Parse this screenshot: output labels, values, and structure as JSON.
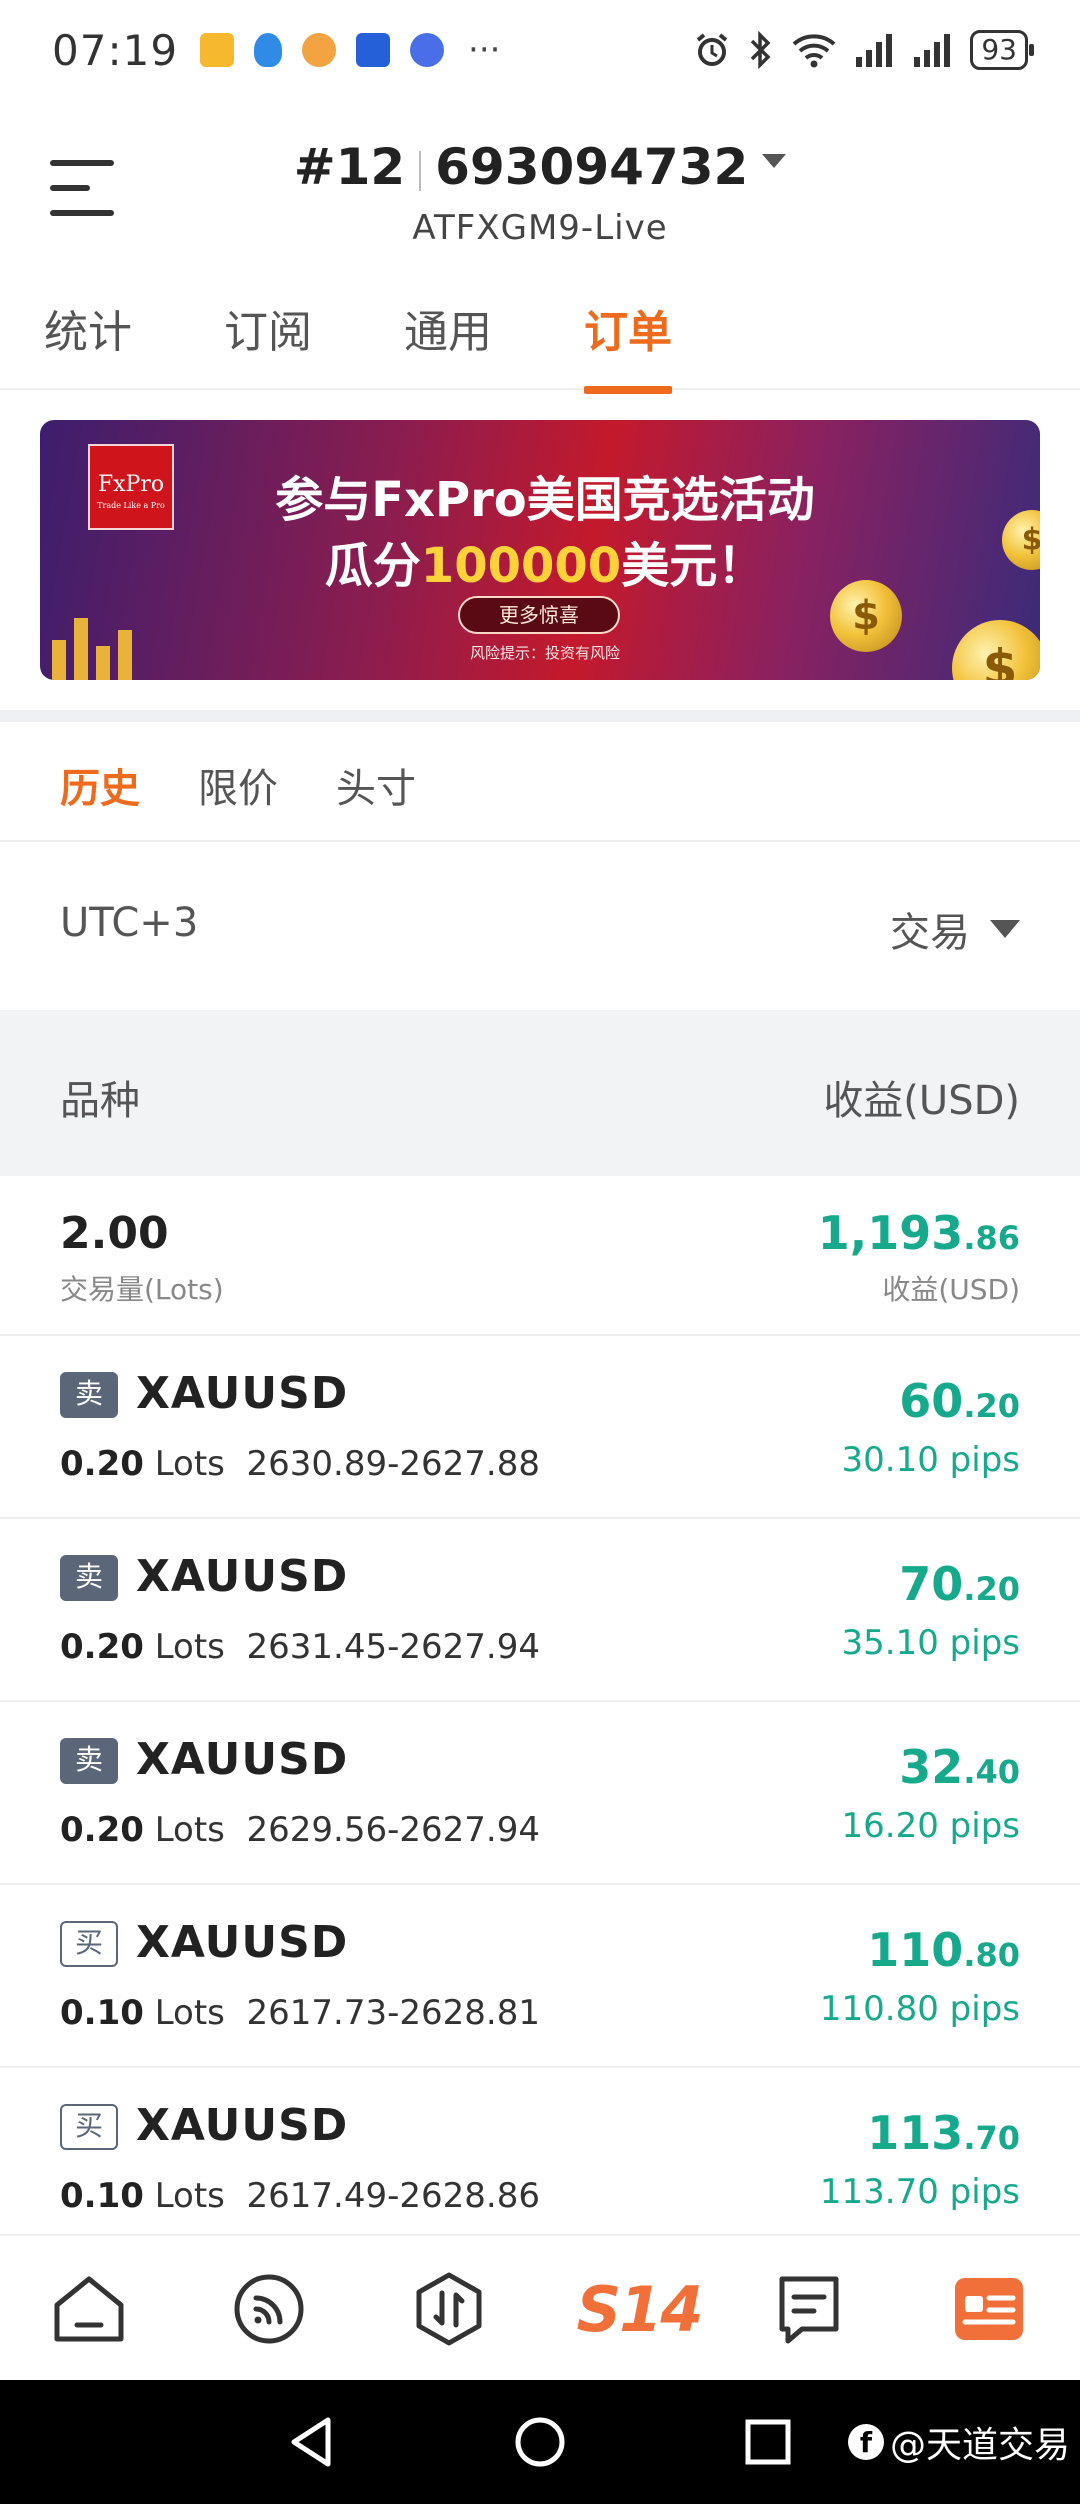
{
  "status_bar": {
    "time": "07:19",
    "more": "···",
    "battery": "93"
  },
  "header": {
    "account_prefix": "#12",
    "account_number": "693094732",
    "server": "ATFXGM9-Live"
  },
  "main_tabs": [
    {
      "label": "统计"
    },
    {
      "label": "订阅"
    },
    {
      "label": "通用"
    },
    {
      "label": "订单",
      "active": true
    }
  ],
  "banner": {
    "logo_text": "FxPro",
    "logo_tagline": "Trade Like a Pro",
    "line1": "参与FxPro美国竞选活动",
    "line2_prefix": "瓜分",
    "line2_amount": "100000",
    "line2_suffix": "美元！",
    "button": "更多惊喜",
    "risk": "风险提示：投资有风险"
  },
  "sub_tabs": [
    {
      "label": "历史",
      "active": true
    },
    {
      "label": "限价"
    },
    {
      "label": "头寸"
    }
  ],
  "filter": {
    "timezone": "UTC+3",
    "type": "交易"
  },
  "columns": {
    "left": "品种",
    "right": "收益(USD)"
  },
  "summary": {
    "lots": "2.00",
    "lots_label": "交易量(Lots)",
    "profit_int": "1,193",
    "profit_dec": ".86",
    "profit_label": "收益(USD)"
  },
  "trades": [
    {
      "side": "卖",
      "side_type": "sell",
      "symbol": "XAUUSD",
      "lots": "0.20",
      "lots_unit": "Lots",
      "range": "2630.89-2627.88",
      "profit_int": "60",
      "profit_dec": ".20",
      "pips": "30.10 pips"
    },
    {
      "side": "卖",
      "side_type": "sell",
      "symbol": "XAUUSD",
      "lots": "0.20",
      "lots_unit": "Lots",
      "range": "2631.45-2627.94",
      "profit_int": "70",
      "profit_dec": ".20",
      "pips": "35.10 pips"
    },
    {
      "side": "卖",
      "side_type": "sell",
      "symbol": "XAUUSD",
      "lots": "0.20",
      "lots_unit": "Lots",
      "range": "2629.56-2627.94",
      "profit_int": "32",
      "profit_dec": ".40",
      "pips": "16.20 pips"
    },
    {
      "side": "买",
      "side_type": "buy",
      "symbol": "XAUUSD",
      "lots": "0.10",
      "lots_unit": "Lots",
      "range": "2617.73-2628.81",
      "profit_int": "110",
      "profit_dec": ".80",
      "pips": "110.80 pips"
    },
    {
      "side": "买",
      "side_type": "buy",
      "symbol": "XAUUSD",
      "lots": "0.10",
      "lots_unit": "Lots",
      "range": "2617.49-2628.86",
      "profit_int": "113",
      "profit_dec": ".70",
      "pips": "113.70 pips"
    }
  ],
  "bottom_nav": {
    "center_label": "S14",
    "icons": [
      "home-icon",
      "feed-icon",
      "trade-icon",
      "s14-logo",
      "message-icon",
      "profile-card-icon"
    ]
  },
  "watermark": "@天道交易",
  "colors": {
    "accent": "#ee6b1d",
    "profit": "#17a98c",
    "sell_badge": "#5b6778"
  }
}
